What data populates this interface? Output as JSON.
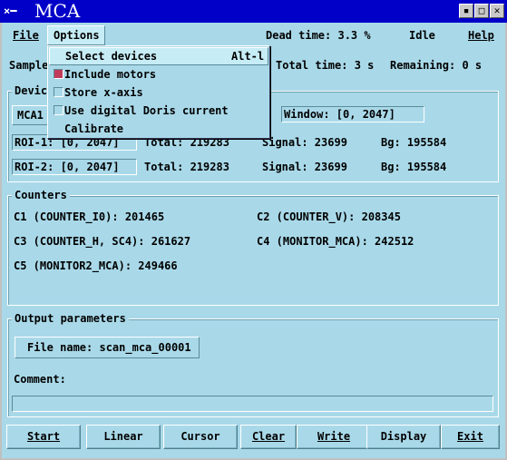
{
  "window": {
    "title": "MCA",
    "app_icon": "X-icon",
    "buttons": [
      "minimize-icon",
      "maximize-icon",
      "close-icon"
    ]
  },
  "menubar": {
    "file": "File",
    "options": "Options",
    "dead_time": "Dead time: 3.3 %",
    "state": "Idle",
    "help": "Help"
  },
  "options_menu": {
    "items": [
      {
        "label": "Select devices",
        "shortcut": "Alt-l",
        "checkbox": null
      },
      {
        "label": "Include motors",
        "checkbox": true
      },
      {
        "label": "Store x-axis",
        "checkbox": false
      },
      {
        "label": "Use digital Doris current",
        "checkbox": false
      },
      {
        "label": "Calibrate",
        "checkbox": null
      }
    ]
  },
  "sample_row": {
    "sample_label": "Sample",
    "total_time": "Total time: 3 s",
    "remaining": "Remaining: 0 s"
  },
  "devices": {
    "group_label": "Devic",
    "device_button": "MCA1",
    "window_field": "Window: [0, 2047]",
    "rois": [
      {
        "field": "ROI-1: [0, 2047]",
        "total": "Total: 219283",
        "signal": "Signal: 23699",
        "bg": "Bg: 195584"
      },
      {
        "field": "ROI-2: [0, 2047]",
        "total": "Total: 219283",
        "signal": "Signal: 23699",
        "bg": "Bg: 195584"
      }
    ]
  },
  "counters": {
    "group_label": "Counters",
    "c1": "C1 (COUNTER_I0): 201465",
    "c2": "C2 (COUNTER_V): 208345",
    "c3": "C3 (COUNTER_H, SC4): 261627",
    "c4": "C4 (MONITOR_MCA): 242512",
    "c5": "C5 (MONITOR2_MCA): 249466"
  },
  "output": {
    "group_label": "Output parameters",
    "file_name": "File name: scan_mca_00001",
    "comment_label": "Comment:",
    "comment_value": ""
  },
  "buttons": {
    "start": "Start",
    "linear": "Linear",
    "cursor": "Cursor",
    "clear": "Clear",
    "write": "Write",
    "display": "Display",
    "exit": "Exit"
  }
}
